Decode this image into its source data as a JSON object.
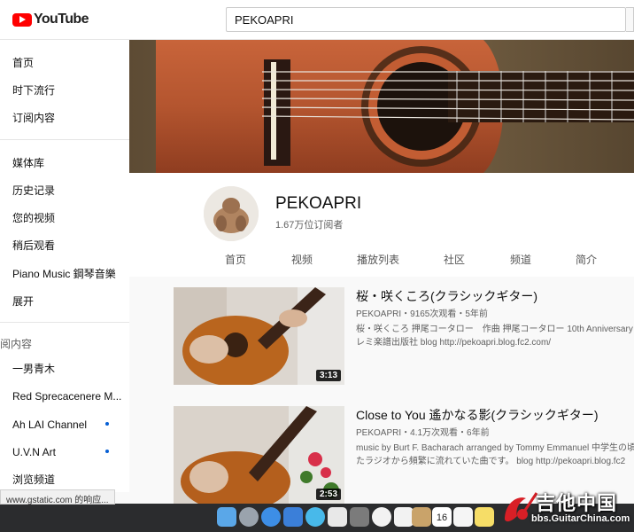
{
  "header": {
    "logo_text": "YouTube",
    "search_value": "PEKOAPRI"
  },
  "sidebar": {
    "items": [
      {
        "label": "首页"
      },
      {
        "label": "时下流行"
      },
      {
        "label": "订阅内容"
      },
      {
        "label": "媒体库"
      },
      {
        "label": "历史记录"
      },
      {
        "label": "您的视频"
      },
      {
        "label": "稍后观看"
      },
      {
        "label": "Piano Music 鋼琴音樂"
      },
      {
        "label": "展开"
      }
    ],
    "subscriptions_title": "订阅内容",
    "subscriptions": [
      {
        "label": "一男青木",
        "new": false
      },
      {
        "label": "Red Sprecacenere M...",
        "new": false
      },
      {
        "label": "Ah LAI Channel",
        "new": true
      },
      {
        "label": "U.V.N Art",
        "new": true
      },
      {
        "label": "浏览频道",
        "new": false
      }
    ]
  },
  "channel": {
    "name": "PEKOAPRI",
    "subscribers": "1.67万位订阅者",
    "tabs": [
      "首页",
      "视频",
      "播放列表",
      "社区",
      "频道",
      "简介"
    ]
  },
  "videos": [
    {
      "title": "桜・咲くころ(クラシックギター)",
      "meta": "PEKOAPRI・9165次观看・5年前",
      "desc_line1": "桜・咲くころ 押尾コータロー　作曲 押尾コータロー 10th Anniversary",
      "desc_line2": "レミ楽譜出版社 blog http://pekoapri.blog.fc2.com/",
      "duration": "3:13"
    },
    {
      "title": "Close to You 遙かなる影(クラシックギター)",
      "meta": "PEKOAPRI・4.1万次观看・6年前",
      "desc_line1": "music by Burt F. Bacharach arranged by Tommy Emmanuel 中学生の頃",
      "desc_line2": "たラジオから頻繁に流れていた曲です。 blog http://pekoapri.blog.fc2",
      "duration": "2:53"
    }
  ],
  "status_text": "www.gstatic.com 的响应...",
  "dock": {
    "calendar_day": "16"
  },
  "watermark": {
    "title": "吉他中国",
    "subtitle": "bbs.GuitarChina.com"
  },
  "colors": {
    "brand_red": "#ff0000",
    "new_dot_blue": "#065fd4"
  }
}
